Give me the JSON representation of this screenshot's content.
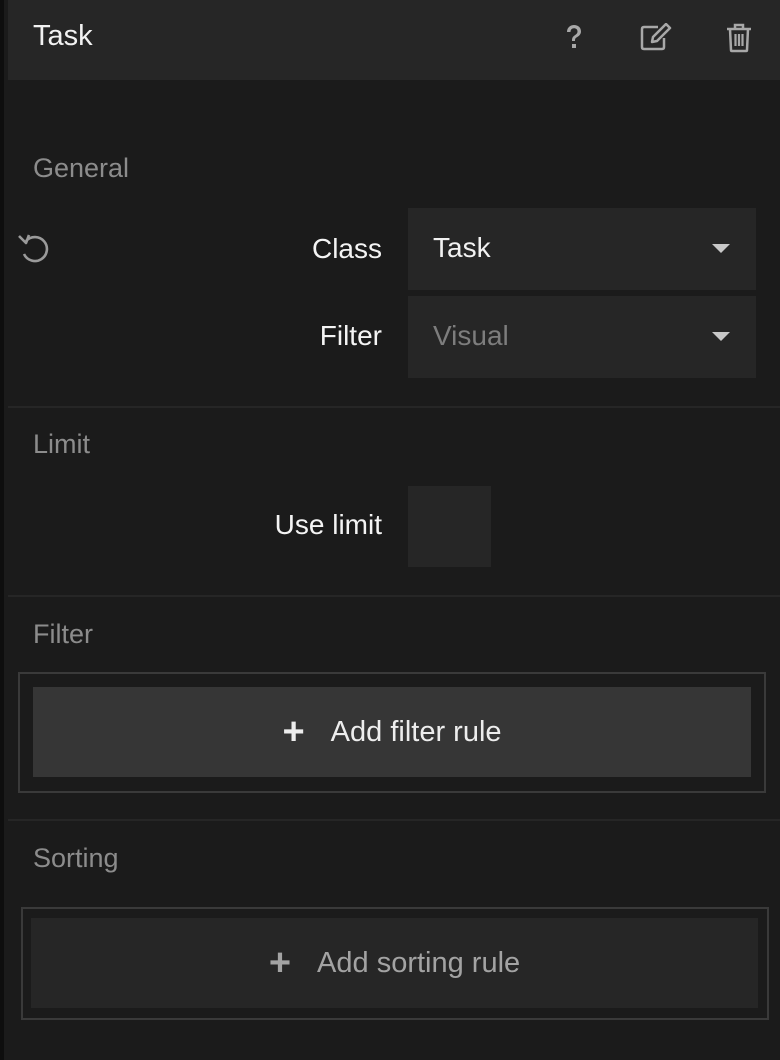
{
  "header": {
    "title": "Task",
    "icons": [
      "help-icon",
      "edit-icon",
      "trash-icon"
    ]
  },
  "sections": {
    "general": {
      "label": "General",
      "class_label": "Class",
      "class_value": "Task",
      "filter_label": "Filter",
      "filter_value": "Visual"
    },
    "limit": {
      "label": "Limit",
      "use_limit_label": "Use limit",
      "use_limit_checked": false
    },
    "filter": {
      "label": "Filter",
      "add_button": "Add filter rule"
    },
    "sorting": {
      "label": "Sorting",
      "add_button": "Add sorting rule"
    }
  },
  "colors": {
    "background": "#1b1b1b",
    "panel": "#262626",
    "muted_text": "#8c8c8c",
    "text": "#f2f2f2"
  }
}
